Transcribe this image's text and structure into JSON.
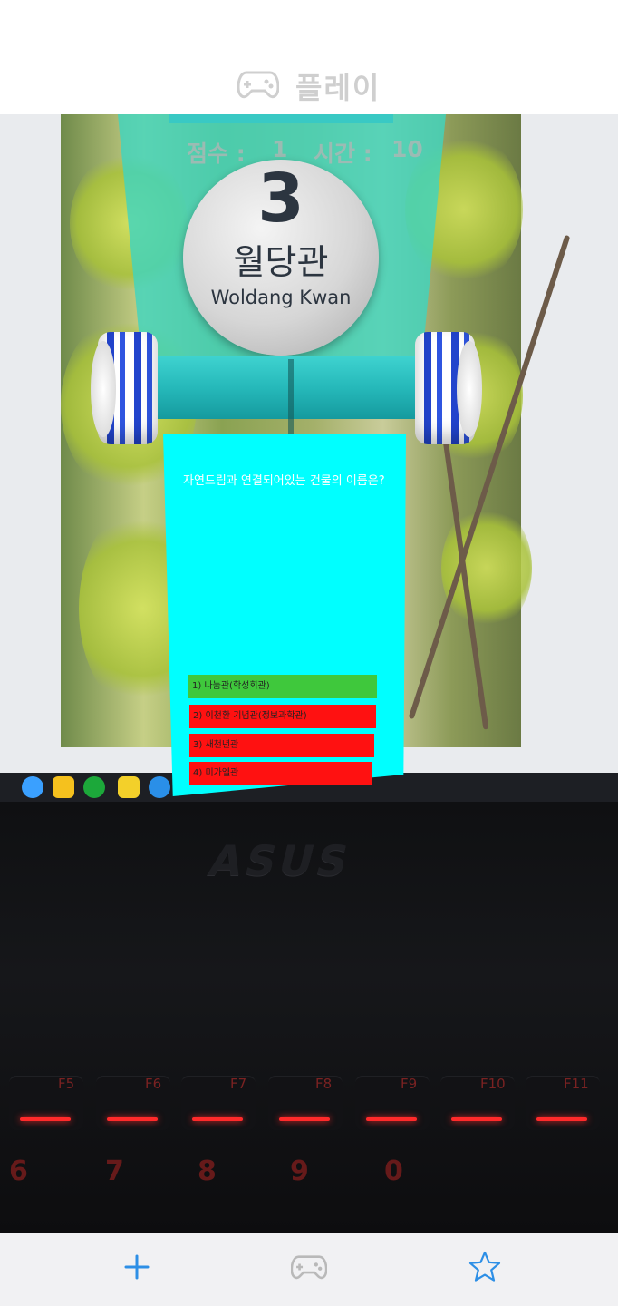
{
  "app_bar": {
    "title": "플레이",
    "icon": "gamepad-icon"
  },
  "ar_overlay": {
    "score_label": "점수 :",
    "score_value": "1",
    "time_label": "시간 :",
    "time_value": "10",
    "sign": {
      "number": "3",
      "korean": "월당관",
      "english": "Woldang Kwan"
    },
    "question": "자연드림과 연결되어있는 건물의 이름은?",
    "answers": [
      {
        "label": "1) 나눔관(학성회관)",
        "color": "#3fc83c"
      },
      {
        "label": "2) 이천환 기념관(정보과학관)",
        "color": "#ff1111"
      },
      {
        "label": "3) 새천년관",
        "color": "#ff1111"
      },
      {
        "label": "4) 미가엘관",
        "color": "#ff1111"
      }
    ]
  },
  "background": {
    "laptop_brand": "ASUS",
    "fn_keys": [
      "F5",
      "F6",
      "F7",
      "F8",
      "F9",
      "F10",
      "F11"
    ],
    "num_keys": [
      "6",
      "7",
      "8",
      "9",
      "0"
    ]
  },
  "bottom_nav": {
    "items": [
      {
        "icon": "plus-icon",
        "color": "#2d8fe6"
      },
      {
        "icon": "gamepad-icon",
        "color": "#b9b9b9"
      },
      {
        "icon": "star-icon",
        "color": "#2d8fe6"
      }
    ]
  }
}
